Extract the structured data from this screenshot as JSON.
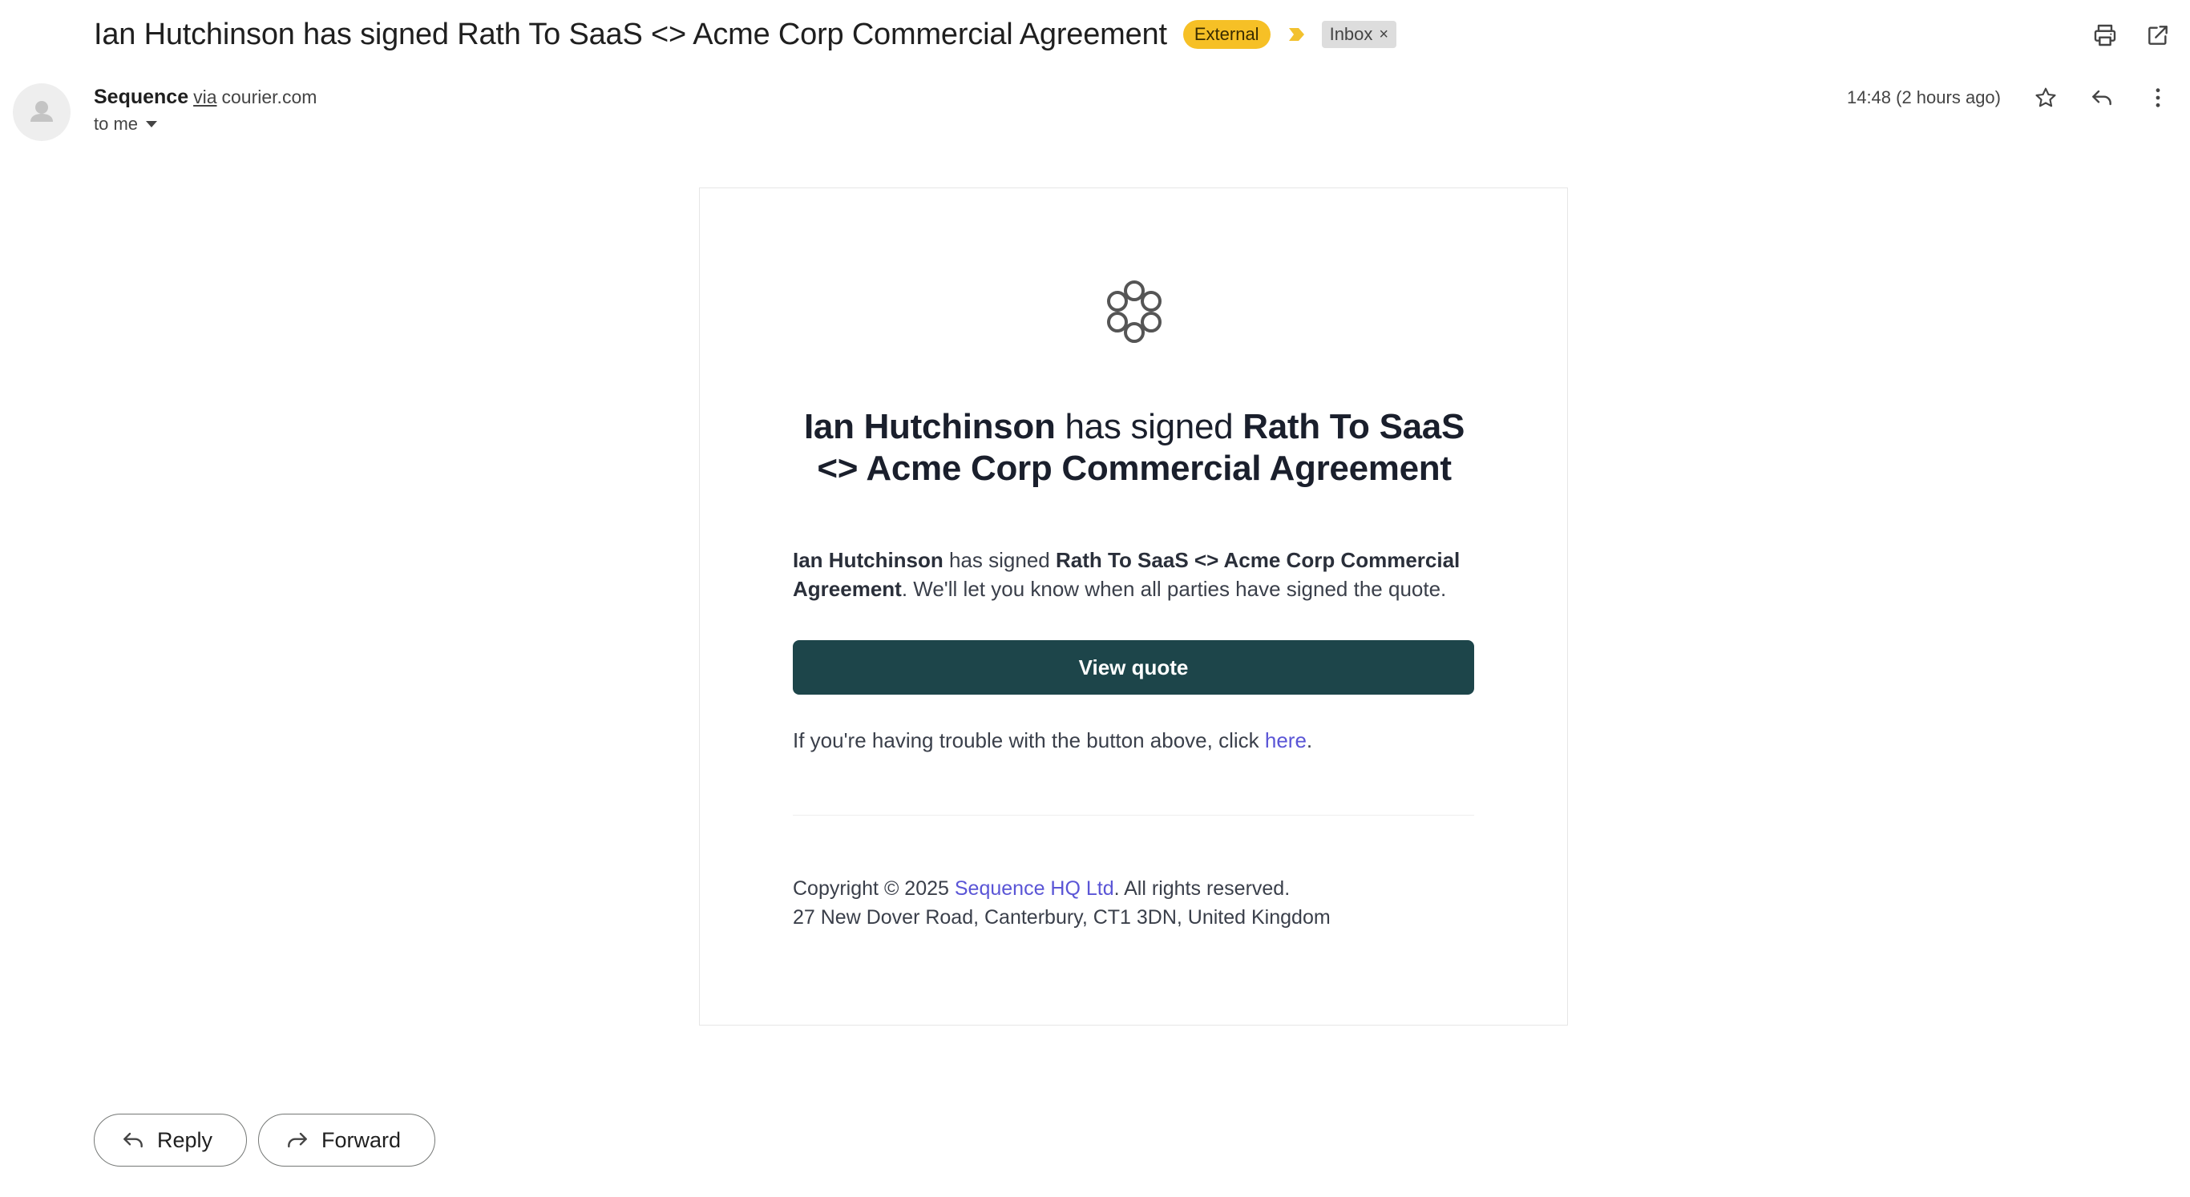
{
  "email": {
    "subject": "Ian Hutchinson has signed Rath To SaaS <> Acme Corp Commercial Agreement",
    "labels": {
      "external": "External",
      "inbox": "Inbox",
      "inbox_remove": "×"
    },
    "sender": {
      "name": "Sequence",
      "via": "via",
      "domain": "courier.com",
      "to": "to me"
    },
    "timestamp": "14:48 (2 hours ago)"
  },
  "content": {
    "headline": {
      "signer": "Ian Hutchinson",
      "action": " has signed ",
      "document": "Rath To SaaS <> Acme Corp Commercial Agreement"
    },
    "body": {
      "signer": "Ian Hutchinson",
      "action": " has signed ",
      "document": "Rath To SaaS <> Acme Corp Commercial Agreement",
      "rest": ". We'll let you know when all parties have signed the quote."
    },
    "cta_label": "View quote",
    "trouble_prefix": "If you're having trouble with the button above, click ",
    "trouble_link": "here",
    "trouble_suffix": ".",
    "footer": {
      "copyright_prefix": "Copyright © 2025 ",
      "company_link": "Sequence HQ Ltd",
      "copyright_suffix": ". All rights reserved.",
      "address": "27 New Dover Road, Canterbury, CT1 3DN, United Kingdom"
    }
  },
  "actions": {
    "reply_label": "Reply",
    "forward_label": "Forward"
  },
  "colors": {
    "external_label": "#f6c026",
    "cta_background": "#1d454a",
    "link": "#5a55d6",
    "importance_marker": "#f2c12e"
  },
  "icons": {
    "print": "printer-icon",
    "open_new_window": "open-in-new-icon",
    "star": "star-icon",
    "reply": "reply-icon",
    "more": "more-vertical-icon",
    "forward": "forward-icon",
    "logo": "sequence-logo-icon"
  }
}
